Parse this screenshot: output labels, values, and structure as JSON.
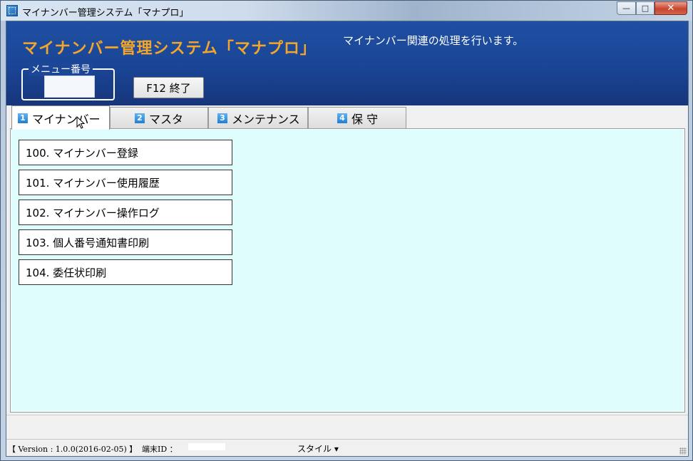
{
  "window": {
    "title": "マイナンバー管理システム「マナプロ」",
    "minimize": "—",
    "maximize": "□",
    "close": "✕"
  },
  "header": {
    "system_title": "マイナンバー管理システム「マナプロ」",
    "description": "マイナンバー関連の処理を行います。",
    "menu_number_label": "メニュー番号",
    "menu_number_value": "",
    "exit_button": "F12  終了"
  },
  "tabs": [
    {
      "num": "1",
      "label": "マイナンバー",
      "active": true
    },
    {
      "num": "2",
      "label": "マスタ",
      "active": false
    },
    {
      "num": "3",
      "label": "メンテナンス",
      "active": false
    },
    {
      "num": "4",
      "label": "保 守",
      "active": false
    }
  ],
  "menu_items": [
    {
      "label": "100.  マイナンバー登録"
    },
    {
      "label": "101.  マイナンバー使用履歴"
    },
    {
      "label": "102.  マイナンバー操作ログ"
    },
    {
      "label": "103.  個人番号通知書印刷"
    },
    {
      "label": "104.  委任状印刷"
    }
  ],
  "statusbar": {
    "version": "【 Version : 1.0.0(2016-02-05) 】",
    "terminal_label": "端末ID  ：",
    "terminal_value": "",
    "style": "スタイル ▾"
  },
  "colors": {
    "header_bg": "#1a4596",
    "title_orange": "#f3a628",
    "panel_bg": "#dffdfd"
  }
}
